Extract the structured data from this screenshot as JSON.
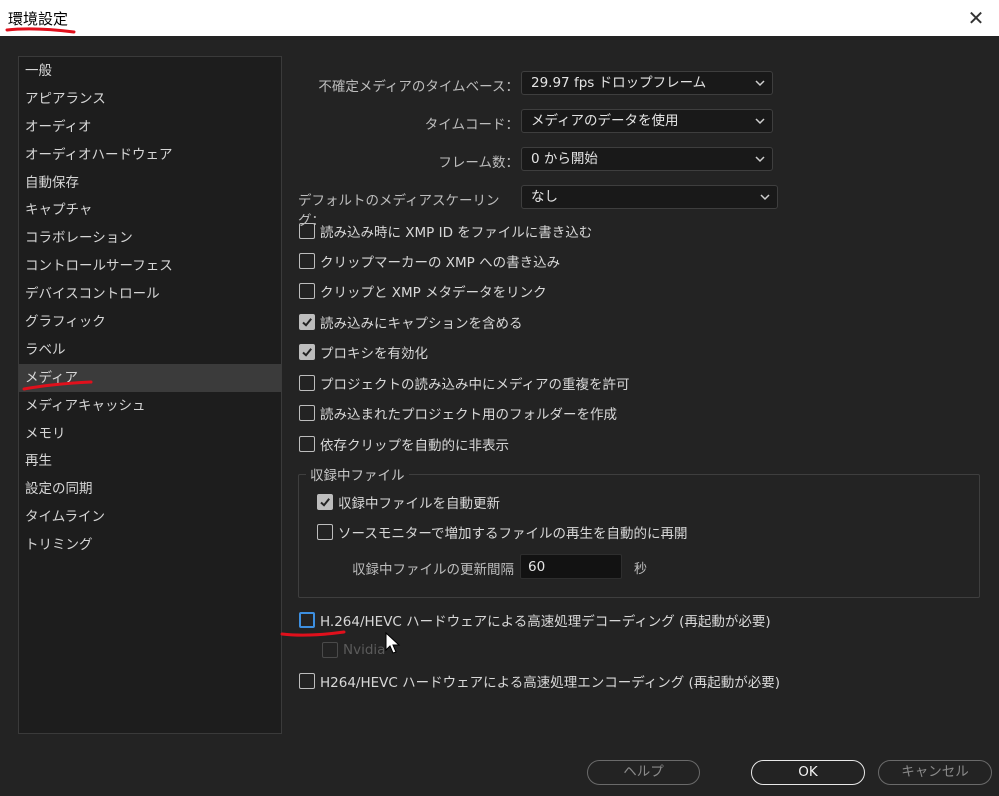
{
  "window": {
    "title": "環境設定",
    "close_glyph": "✕"
  },
  "sidebar": {
    "items": [
      {
        "label": "一般"
      },
      {
        "label": "アピアランス"
      },
      {
        "label": "オーディオ"
      },
      {
        "label": "オーディオハードウェア"
      },
      {
        "label": "自動保存"
      },
      {
        "label": "キャプチャ"
      },
      {
        "label": "コラボレーション"
      },
      {
        "label": "コントロールサーフェス"
      },
      {
        "label": "デバイスコントロール"
      },
      {
        "label": "グラフィック"
      },
      {
        "label": "ラベル"
      },
      {
        "label": "メディア",
        "selected": true
      },
      {
        "label": "メディアキャッシュ"
      },
      {
        "label": "メモリ"
      },
      {
        "label": "再生"
      },
      {
        "label": "設定の同期"
      },
      {
        "label": "タイムライン"
      },
      {
        "label": "トリミング"
      }
    ]
  },
  "media": {
    "timebase": {
      "label": "不確定メディアのタイムベース：",
      "value": "29.97  fps ドロップフレーム"
    },
    "timecode": {
      "label": "タイムコード：",
      "value": "メディアのデータを使用"
    },
    "frame_count": {
      "label": "フレーム数：",
      "value": "0 から開始"
    },
    "default_scaling": {
      "label": "デフォルトのメディアスケーリング：",
      "value": "なし"
    },
    "checkboxes": [
      {
        "label": "読み込み時に XMP ID をファイルに書き込む",
        "checked": false
      },
      {
        "label": "クリップマーカーの XMP への書き込み",
        "checked": false
      },
      {
        "label": "クリップと XMP メタデータをリンク",
        "checked": false
      },
      {
        "label": "読み込みにキャプションを含める",
        "checked": true
      },
      {
        "label": "プロキシを有効化",
        "checked": true
      },
      {
        "label": "プロジェクトの読み込み中にメディアの重複を許可",
        "checked": false
      },
      {
        "label": "読み込まれたプロジェクト用のフォルダーを作成",
        "checked": false
      },
      {
        "label": "依存クリップを自動的に非表示",
        "checked": false
      }
    ],
    "growing_files": {
      "legend": "収録中ファイル",
      "auto_refresh": {
        "label": "収録中ファイルを自動更新",
        "checked": true
      },
      "auto_resume": {
        "label": "ソースモニターで増加するファイルの再生を自動的に再開",
        "checked": false
      },
      "interval": {
        "label": "収録中ファイルの更新間隔",
        "value": "60",
        "unit": "秒"
      }
    },
    "hw_decoding": {
      "label": "H.264/HEVC ハードウェアによる高速処理デコーディング (再起動が必要)",
      "checked": false
    },
    "nvidia": {
      "label": "Nvidia",
      "checked": false
    },
    "hw_encoding": {
      "label": "H264/HEVC ハードウェアによる高速処理エンコーディング (再起動が必要)",
      "checked": false
    }
  },
  "buttons": {
    "help": "ヘルプ",
    "ok": "OK",
    "cancel": "キャンセル"
  },
  "colors": {
    "annotation": "#e0101c",
    "focus": "#3d8fe0",
    "background": "#232323"
  }
}
